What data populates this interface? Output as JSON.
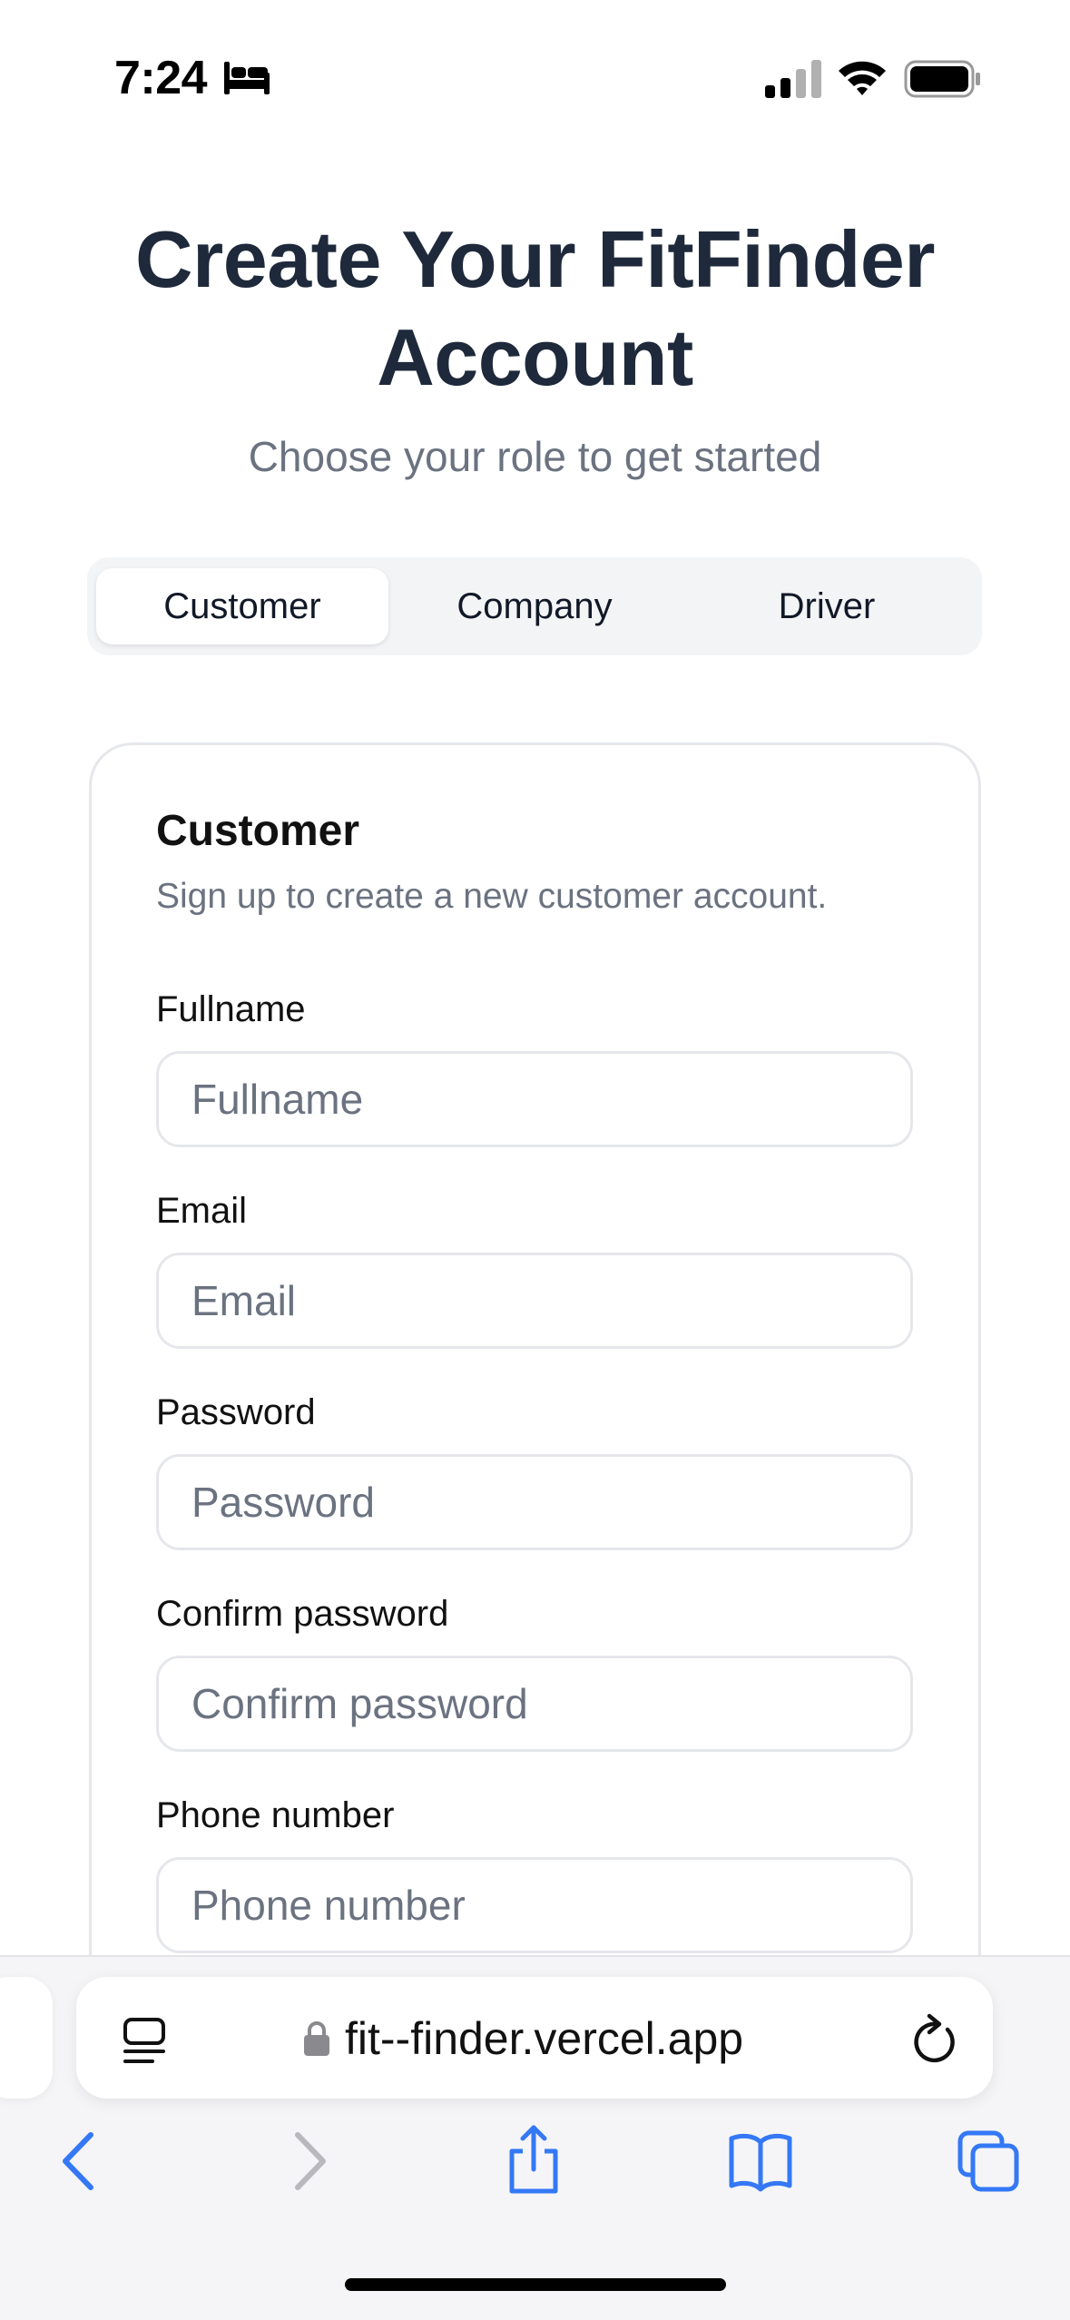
{
  "status_bar": {
    "time": "7:24",
    "focus_icon": "bed-icon",
    "signal_icon": "cellular-signal-icon",
    "wifi_icon": "wifi-icon",
    "battery_icon": "battery-icon"
  },
  "header": {
    "title": "Create Your FitFinder Account",
    "subtitle": "Choose your role to get started"
  },
  "role_tabs": [
    {
      "label": "Customer",
      "active": true
    },
    {
      "label": "Company",
      "active": false
    },
    {
      "label": "Driver",
      "active": false
    }
  ],
  "form": {
    "title": "Customer",
    "description": "Sign up to create a new customer account.",
    "fields": [
      {
        "label": "Fullname",
        "placeholder": "Fullname",
        "value": ""
      },
      {
        "label": "Email",
        "placeholder": "Email",
        "value": ""
      },
      {
        "label": "Password",
        "placeholder": "Password",
        "value": ""
      },
      {
        "label": "Confirm password",
        "placeholder": "Confirm password",
        "value": ""
      },
      {
        "label": "Phone number",
        "placeholder": "Phone number",
        "value": ""
      }
    ]
  },
  "browser": {
    "url": "fit--finder.vercel.app",
    "icons": [
      "reader-icon",
      "lock-icon",
      "reload-icon",
      "back-icon",
      "forward-icon",
      "share-icon",
      "bookmarks-icon",
      "tabs-icon"
    ]
  },
  "colors": {
    "title": "#1e293b",
    "muted_text": "#6b7280",
    "tab_track": "#f3f4f6",
    "border": "#e5e7eb",
    "browser_accent": "#3478f6",
    "browser_disabled": "#b8b8bd"
  }
}
